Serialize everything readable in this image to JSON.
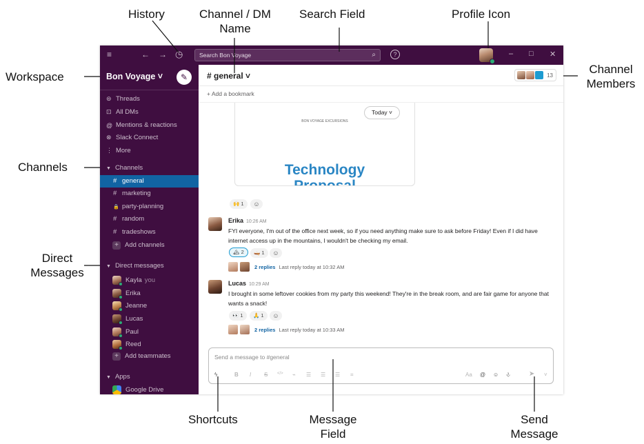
{
  "callouts": {
    "history": "History",
    "channel_dm_name_1": "Channel / DM",
    "channel_dm_name_2": "Name",
    "search_field": "Search Field",
    "profile_icon": "Profile Icon",
    "workspace": "Workspace",
    "channel_members_1": "Channel",
    "channel_members_2": "Members",
    "channels": "Channels",
    "direct_messages_1": "Direct",
    "direct_messages_2": "Messages",
    "shortcuts": "Shortcuts",
    "message_field_1": "Message",
    "message_field_2": "Field",
    "send_message_1": "Send",
    "send_message_2": "Message"
  },
  "titlebar": {
    "menu_icon": "≡",
    "back_icon": "←",
    "forward_icon": "→",
    "history_icon": "◷",
    "search_placeholder": "Search Bon Voyage",
    "search_icon": "⌕",
    "help_icon": "?",
    "minimize": "–",
    "maximize": "□",
    "close": "✕"
  },
  "sidebar": {
    "workspace_name": "Bon Voyage ˅",
    "compose_icon": "✎",
    "nav": [
      {
        "icon": "⊜",
        "label": "Threads"
      },
      {
        "icon": "⊡",
        "label": "All DMs"
      },
      {
        "icon": "@",
        "label": "Mentions & reactions"
      },
      {
        "icon": "⊗",
        "label": "Slack Connect"
      },
      {
        "icon": "⋮",
        "label": "More"
      }
    ],
    "channels_header": "Channels",
    "channels": [
      {
        "prefix": "#",
        "label": "general"
      },
      {
        "prefix": "#",
        "label": "marketing"
      },
      {
        "prefix": "🔒",
        "label": "party-planning"
      },
      {
        "prefix": "#",
        "label": "random"
      },
      {
        "prefix": "#",
        "label": "tradeshows"
      }
    ],
    "add_channels": "Add channels",
    "dm_header": "Direct messages",
    "dms": [
      {
        "name": "Kayla",
        "suffix": "you"
      },
      {
        "name": "Erika",
        "suffix": ""
      },
      {
        "name": "Jeanne",
        "suffix": ""
      },
      {
        "name": "Lucas",
        "suffix": ""
      },
      {
        "name": "Paul",
        "suffix": ""
      },
      {
        "name": "Reed",
        "suffix": ""
      }
    ],
    "add_teammates": "Add teammates",
    "apps_header": "Apps",
    "apps": [
      {
        "name": "Google Drive"
      }
    ]
  },
  "channel": {
    "name": "# general ˅",
    "member_count": "13",
    "add_bookmark": "+ Add a bookmark",
    "today_pill": "Today ˅"
  },
  "preview": {
    "caption": "BON VOYAGE EXCURSIONS",
    "title_line1": "Technology",
    "title_line2": "Proposal",
    "reaction": "🙌 1"
  },
  "messages": [
    {
      "author": "Erika",
      "time": "10:26 AM",
      "text": "FYI everyone, I'm out of the office next week, so if you need anything make sure to ask before Friday! Even if I did have internet access up in the mountains, I wouldn't be checking my email.",
      "reactions": [
        "🏔 2",
        "🛶 1"
      ],
      "replies": "2 replies",
      "last_reply": "Last reply today at 10:32 AM"
    },
    {
      "author": "Lucas",
      "time": "10:29 AM",
      "text": "I brought in some leftover cookies from my party this weekend! They're in the break room, and are fair game for anyone that wants a snack!",
      "reactions": [
        "👀 1",
        "🙏 1"
      ],
      "replies": "2 replies",
      "last_reply": "Last reply today at 10:33 AM"
    }
  ],
  "composer": {
    "placeholder": "Send a message to #general",
    "shortcuts_icon": "ϟ",
    "bold": "B",
    "italic": "I",
    "strike": "S",
    "code": "</>",
    "link": "⌁",
    "ordered_list": "☰",
    "bullet_list": "☰",
    "quote": "☰",
    "code_block": "⌗",
    "format": "Aa",
    "mention": "@",
    "emoji": "☺",
    "attach": "⎀",
    "send": "➤",
    "send_options": "˅"
  },
  "colors": {
    "sidebar_bg": "#3f0e40",
    "active_channel": "#1164a3",
    "link": "#1264a3",
    "presence": "#2bac76"
  }
}
